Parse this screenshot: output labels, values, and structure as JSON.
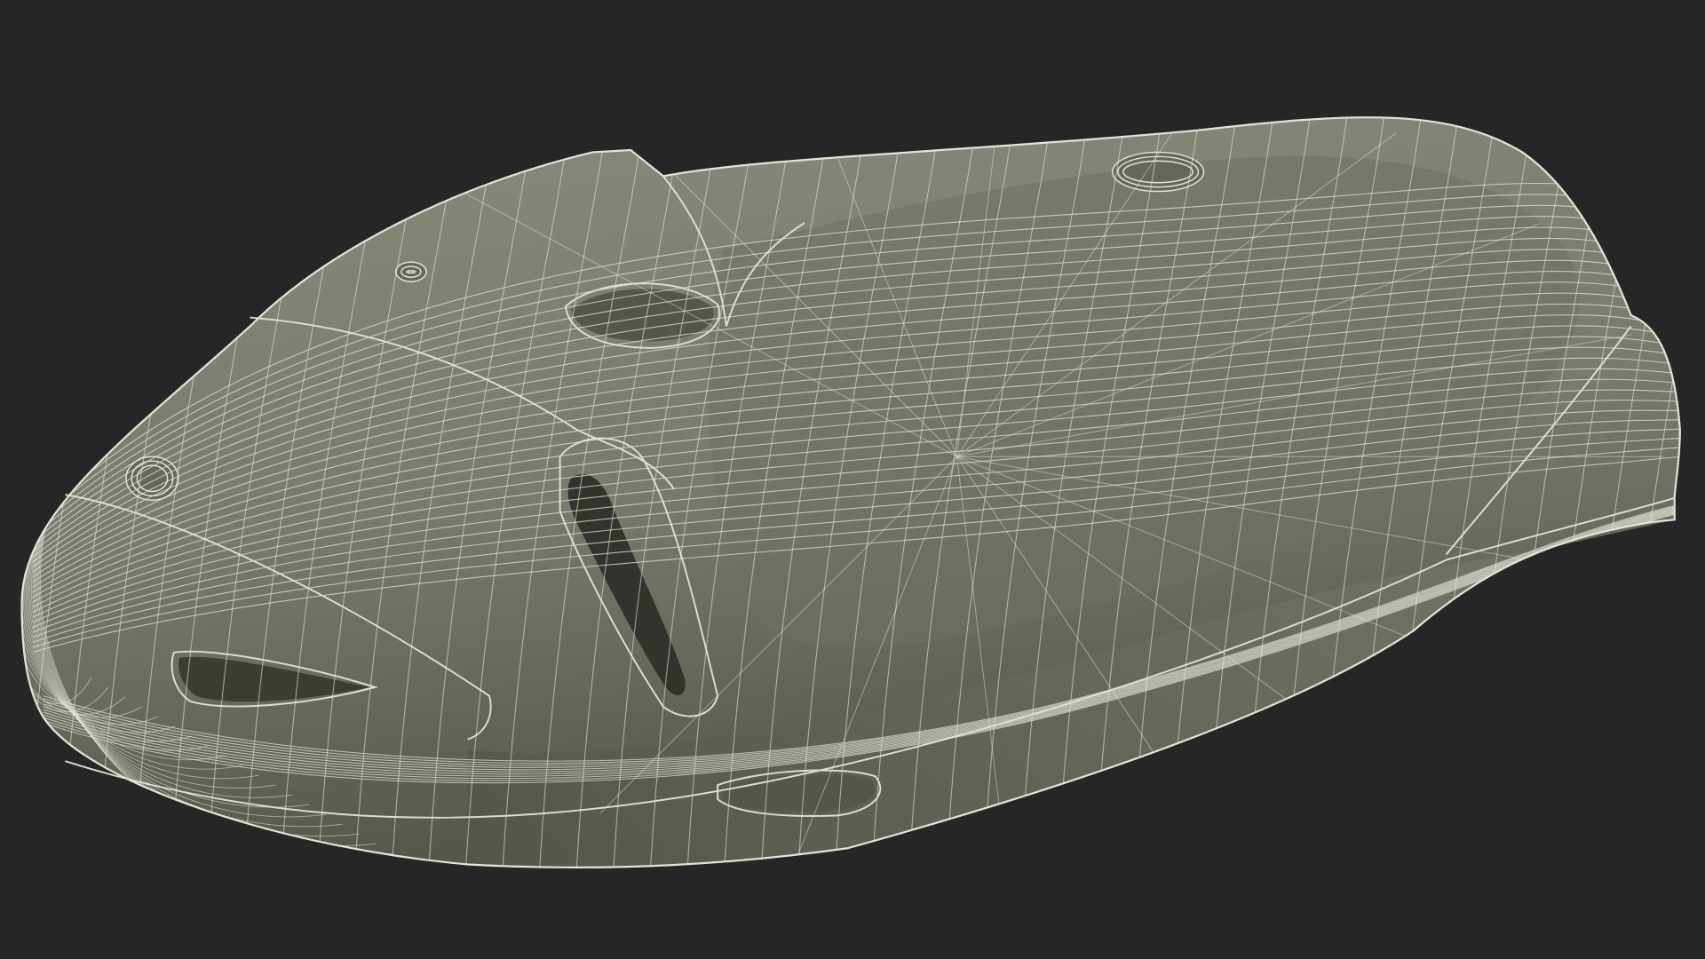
{
  "scene": {
    "subject": "wireframe-3d-model",
    "colors": {
      "background": "#262626",
      "surface_base": "#7a7a6c",
      "surface_light": "#8a8a7c",
      "surface_dark": "#55554a",
      "recess": "#33332d",
      "wire": "#e4e4d6"
    }
  }
}
